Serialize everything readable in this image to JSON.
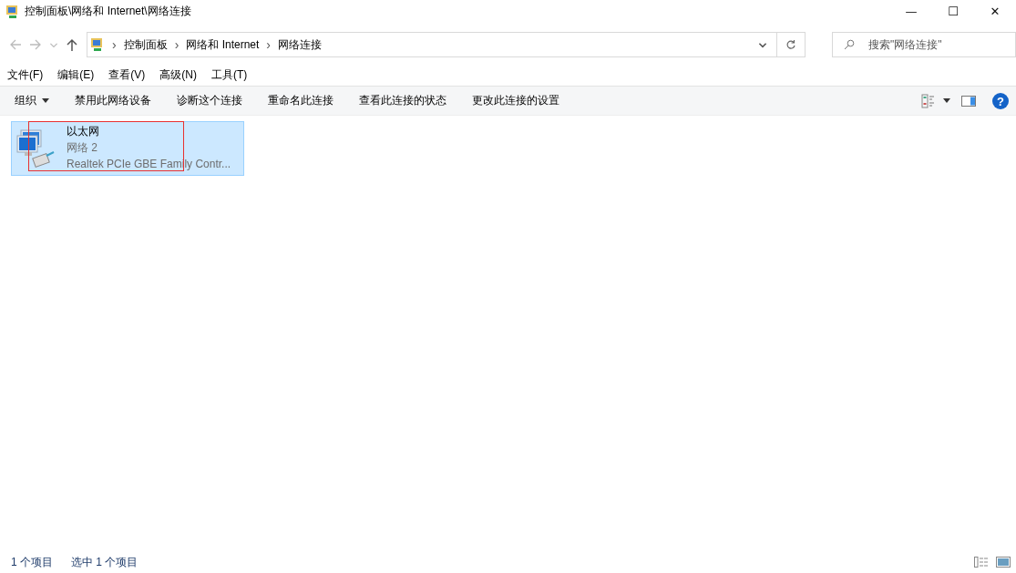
{
  "window": {
    "title": "控制面板\\网络和 Internet\\网络连接",
    "controls": [
      "—",
      "☐",
      "✕"
    ]
  },
  "address_bar": {
    "breadcrumbs": [
      "控制面板",
      "网络和 Internet",
      "网络连接"
    ],
    "separator": "›"
  },
  "search": {
    "placeholder": "搜索\"网络连接\""
  },
  "menu": [
    "文件(F)",
    "编辑(E)",
    "查看(V)",
    "高级(N)",
    "工具(T)"
  ],
  "commands": [
    {
      "label": "组织",
      "dropdown": true
    },
    {
      "label": "禁用此网络设备",
      "dropdown": false
    },
    {
      "label": "诊断这个连接",
      "dropdown": false
    },
    {
      "label": "重命名此连接",
      "dropdown": false
    },
    {
      "label": "查看此连接的状态",
      "dropdown": false
    },
    {
      "label": "更改此连接的设置",
      "dropdown": false
    }
  ],
  "items": [
    {
      "name": "以太网",
      "network": "网络 2",
      "adapter": "Realtek PCIe GBE Family Contr...",
      "selected": true
    }
  ],
  "help": "?",
  "status_bar": [
    "1 个项目",
    "选中 1 个项目"
  ]
}
